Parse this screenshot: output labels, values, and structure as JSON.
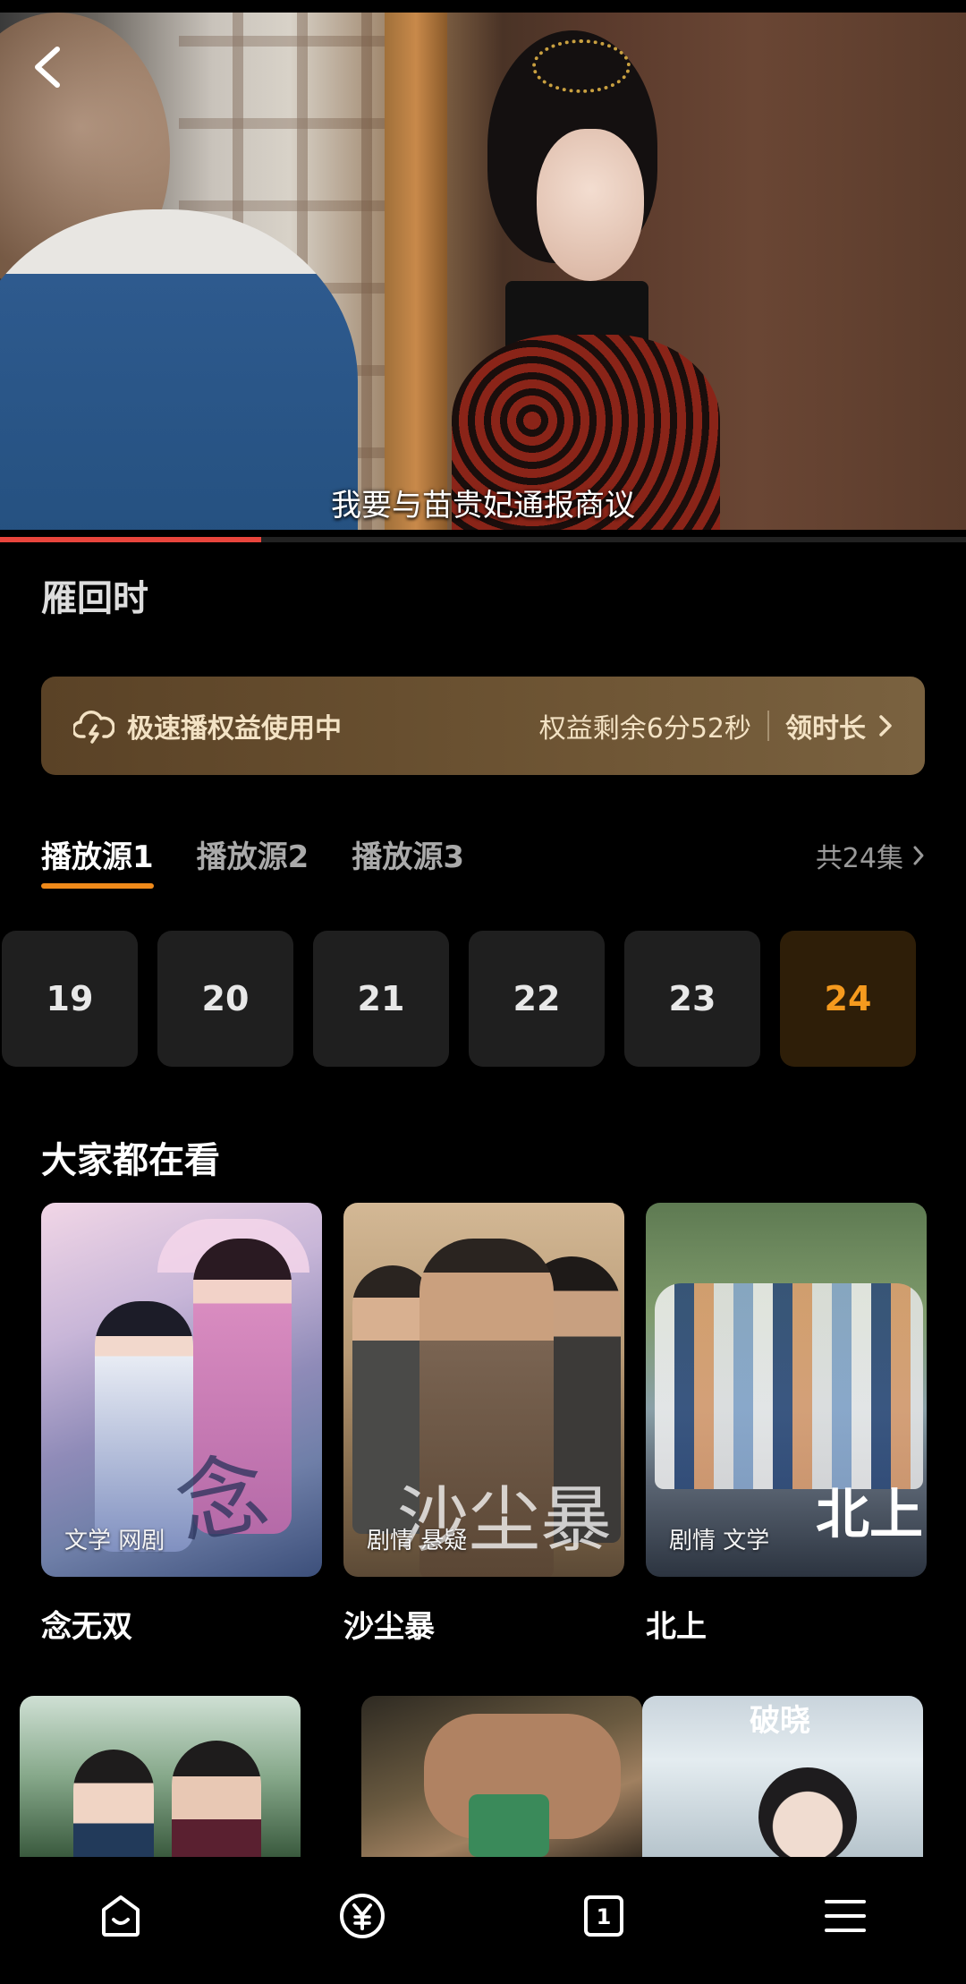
{
  "player": {
    "subtitle": "我要与苗贵妃通报商议",
    "progress_fraction": 0.27
  },
  "show": {
    "title": "雁回时"
  },
  "speed_banner": {
    "label": "极速播权益使用中",
    "remaining": "权益剩余6分52秒",
    "claim": "领时长"
  },
  "sources": {
    "tabs": [
      {
        "label": "播放源1",
        "active": true
      },
      {
        "label": "播放源2",
        "active": false
      },
      {
        "label": "播放源3",
        "active": false
      }
    ],
    "episode_count": "共24集"
  },
  "episodes": [
    {
      "label": "19",
      "active": false
    },
    {
      "label": "20",
      "active": false
    },
    {
      "label": "21",
      "active": false
    },
    {
      "label": "22",
      "active": false
    },
    {
      "label": "23",
      "active": false
    },
    {
      "label": "24",
      "active": true
    }
  ],
  "recommendations": {
    "title": "大家都在看",
    "items": [
      {
        "name": "念无双",
        "tags": "文学 网剧",
        "poster_text": "念"
      },
      {
        "name": "沙尘暴",
        "tags": "剧情 悬疑",
        "poster_text": "沙尘暴"
      },
      {
        "name": "北上",
        "tags": "剧情 文学",
        "poster_text": "北上"
      }
    ],
    "row2_poster_text": "破晓"
  },
  "nav": {
    "icons": [
      "home-icon",
      "yuan-icon",
      "tab-count-icon",
      "menu-icon"
    ],
    "tab_count": "1"
  },
  "colors": {
    "accent": "#f08a1a",
    "progress": "#e8453c",
    "episode_active_text": "#f59a1e",
    "banner_text": "#f3e2c4"
  }
}
